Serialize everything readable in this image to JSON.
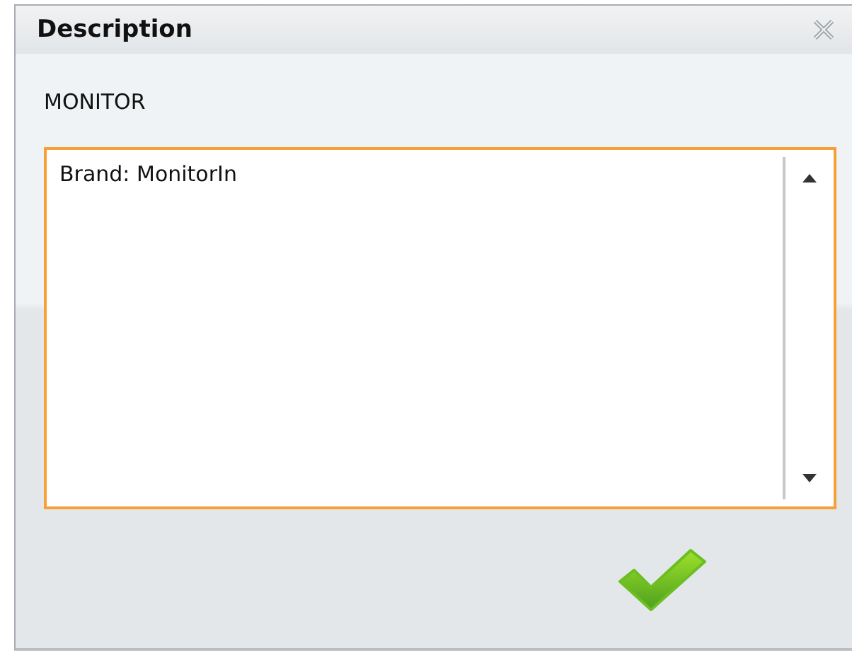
{
  "window": {
    "title": "Description"
  },
  "label": "MONITOR",
  "description_field": {
    "value": "Brand: MonitorIn",
    "focused": true
  },
  "buttons": [
    {
      "kind": "confirm"
    }
  ]
}
